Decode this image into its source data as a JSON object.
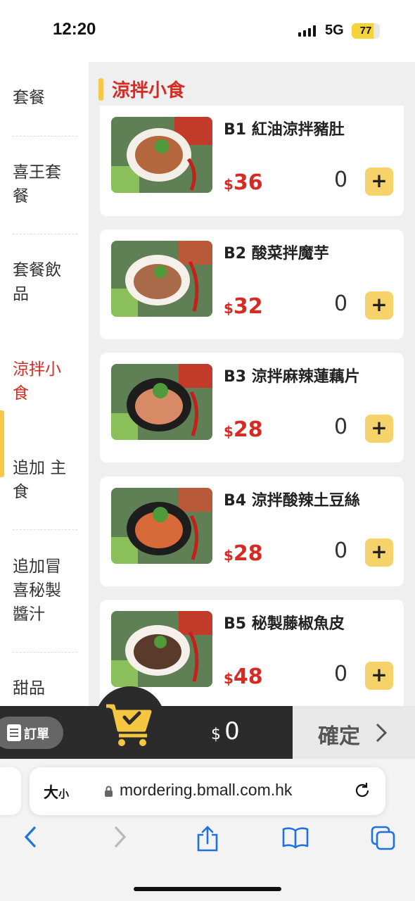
{
  "status": {
    "time": "12:20",
    "network": "5G",
    "battery": "77",
    "battery_level": 0.77
  },
  "sidebar": {
    "items": [
      {
        "label": "套餐"
      },
      {
        "label": "喜王套餐"
      },
      {
        "label": "套餐飲品"
      },
      {
        "label": "涼拌小食"
      },
      {
        "label": "追加 主食"
      },
      {
        "label": "追加冒喜秘製醬汁"
      },
      {
        "label": "甜品"
      }
    ]
  },
  "section": {
    "title": "涼拌小食"
  },
  "products": [
    {
      "name": "B1 紅油涼拌豬肚",
      "currency": "$",
      "price": "36",
      "qty": "0",
      "add": "+"
    },
    {
      "name": "B2 酸菜拌魔芋",
      "currency": "$",
      "price": "32",
      "qty": "0",
      "add": "+"
    },
    {
      "name": "B3 涼拌麻辣蓮藕片",
      "currency": "$",
      "price": "28",
      "qty": "0",
      "add": "+"
    },
    {
      "name": "B4 涼拌酸辣土豆絲",
      "currency": "$",
      "price": "28",
      "qty": "0",
      "add": "+"
    },
    {
      "name": "B5 秘製藤椒魚皮",
      "currency": "$",
      "price": "48",
      "qty": "0",
      "add": "+"
    }
  ],
  "cart": {
    "order_label": "訂單",
    "currency": "$",
    "total": "0",
    "confirm_label": "確定"
  },
  "browser": {
    "text_size_big": "大",
    "text_size_small": "小",
    "url": "mordering.bmall.com.hk"
  },
  "colors": {
    "accent_red": "#d62b23",
    "accent_yellow": "#f5d36a",
    "cart_bg": "#2b2b2b"
  },
  "icons": [
    "back-icon",
    "forward-icon",
    "share-icon",
    "bookmarks-icon",
    "tabs-icon",
    "reload-icon",
    "lock-icon",
    "cart-icon",
    "clipboard-icon"
  ]
}
